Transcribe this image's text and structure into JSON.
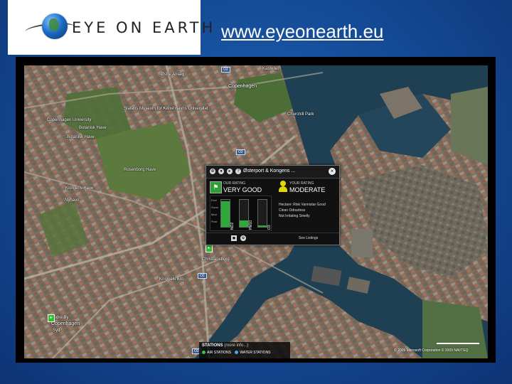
{
  "header": {
    "logo_text": "EYE ON EARTH",
    "url_text": "www.eyeonearth.eu"
  },
  "map": {
    "labels": {
      "copenhagen_top": "Copenhagen",
      "ostre_anlaeg": "Østre Anlæg",
      "kastellet": "Kastellet",
      "kobenhavns_universitet": "Københavns Universitet",
      "statens_museum": "Statens Museum for Kunst",
      "copenhagen_university": "Copenhagen University",
      "botanisk_have": "Botanisk Have",
      "botanisk_have_2": "Botanisk Have",
      "churchill_park": "Churchill Park",
      "rosenborg_have": "Rosenborg Have",
      "kongens_have": "Kongens Have",
      "nyhavn": "Nyhavn",
      "christiansborg": "Christiansborg",
      "knippels_bro": "Knippels Bro",
      "indre_by": "Indre By",
      "copenhagen_bottom": "Copenhagen",
      "syd": "Syd"
    },
    "road_badges": [
      "O2",
      "O2",
      "O2",
      "O2"
    ],
    "copyright": "© 2009 Microsoft Corporation  © 2009 NAVTEQ"
  },
  "popup": {
    "title": "Østerport & Kongens ...",
    "our_rating_label": "OUR RATING",
    "our_rating_value": "VERY GOOD",
    "your_rating_label": "YOUR RATING",
    "your_rating_value": "MODERATE",
    "axis_labels": [
      "Excl",
      "Good",
      "Mod",
      "Poor"
    ],
    "bars": [
      {
        "label": "NO2",
        "level": 0.95
      },
      {
        "label": "PM10",
        "level": 0.25
      },
      {
        "label": "O3",
        "level": 0.05
      }
    ],
    "bar_legends": [
      "NO2",
      "PM10",
      "O3"
    ],
    "your_lines": [
      "Hectare: Risk Vannistar Good",
      "Clean Odourless",
      "Not Irritating Smelly"
    ],
    "footer_link": "See Listings"
  },
  "stations": {
    "title": "STATIONS",
    "title_sub": "(more info...)",
    "air": "AIR STATIONS",
    "water": "WATER STATIONS",
    "air_color": "#3fbf3f",
    "water_color": "#49a8e6"
  },
  "colors": {
    "background": "#154c98",
    "good_green": "#2fa83a",
    "moderate_yellow": "#e2d800"
  }
}
